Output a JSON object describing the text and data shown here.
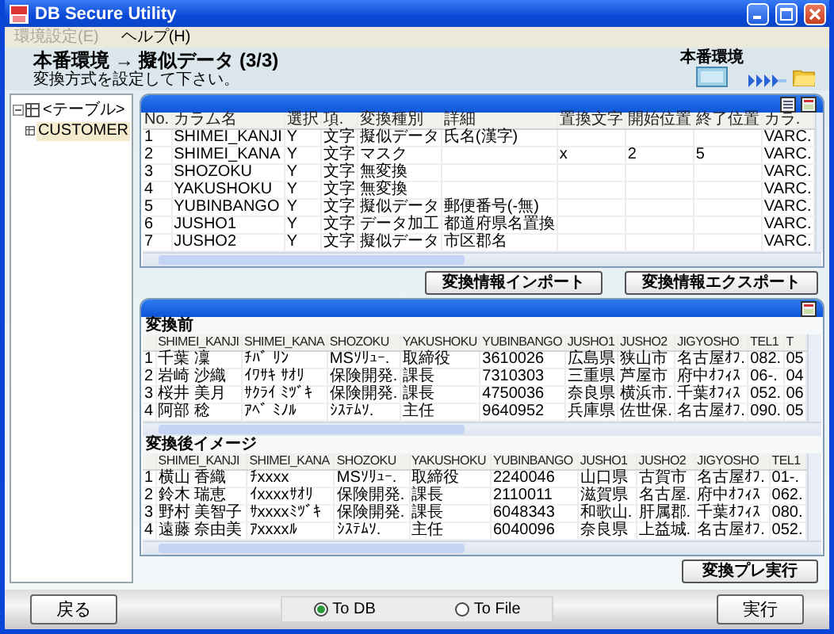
{
  "window": {
    "title": "DB Secure Utility"
  },
  "menu": [
    {
      "label": "環境設定(E)",
      "disabled": true
    },
    {
      "label": "ヘルプ(H)",
      "disabled": false
    }
  ],
  "header": {
    "title": "本番環境 → 擬似データ (3/3)",
    "subtitle": "変換方式を設定して下さい。",
    "icon_label": "本番環境"
  },
  "tree": {
    "label": "<テーブル>",
    "expanded": true,
    "children": [
      {
        "label": "CUSTOMER",
        "selected": true
      }
    ]
  },
  "settings_table": {
    "columns": [
      "No.",
      "カラム名",
      "選択",
      "項.",
      "変換種別",
      "詳細",
      "置換文字",
      "開始位置",
      "終了位置",
      "カラ."
    ],
    "rows": [
      [
        "1",
        "SHIMEI_KANJI",
        "Y",
        "文字",
        "擬似データ",
        "氏名(漢字)",
        null,
        null,
        null,
        "VARC."
      ],
      [
        "2",
        "SHIMEI_KANA",
        "Y",
        "文字",
        "マスク",
        null,
        "x",
        "2",
        "5",
        "VARC."
      ],
      [
        "3",
        "SHOZOKU",
        "Y",
        "文字",
        "無変換",
        null,
        null,
        null,
        null,
        "VARC."
      ],
      [
        "4",
        "YAKUSHOKU",
        "Y",
        "文字",
        "無変換",
        null,
        null,
        null,
        null,
        "VARC."
      ],
      [
        "5",
        "YUBINBANGO",
        "Y",
        "文字",
        "擬似データ",
        "郵便番号(-無)",
        null,
        null,
        null,
        "VARC."
      ],
      [
        "6",
        "JUSHO1",
        "Y",
        "文字",
        "データ加工",
        "都道府県名置換",
        null,
        null,
        null,
        "VARC."
      ],
      [
        "7",
        "JUSHO2",
        "Y",
        "文字",
        "擬似データ",
        "市区郡名",
        null,
        null,
        null,
        "VARC."
      ]
    ]
  },
  "settings_buttons": [
    "変換情報インポート",
    "変換情報エクスポート"
  ],
  "preview": {
    "before": {
      "label": "変換前",
      "columns": [
        "",
        "SHIMEI_KANJI",
        "SHIMEI_KANA",
        "SHOZOKU",
        "YAKUSHOKU",
        "YUBINBANGO",
        "JUSHO1",
        "JUSHO2",
        "JIGYOSHO",
        "TEL1",
        "T"
      ],
      "rows": [
        [
          "1",
          "千葉 凜",
          "ﾁﾊﾞ ﾘﾝ",
          "MSｿﾘｭｰ.",
          "取締役",
          "3610026",
          "広島県",
          "狭山市",
          "名古屋ｵﾌ.",
          "082.",
          "05"
        ],
        [
          "2",
          "岩崎 沙織",
          "ｲﾜｻｷ ｻｵﾘ",
          "保険開発.",
          "課長",
          "7310303",
          "三重県",
          "芦屋市",
          "府中ｵﾌｨｽ",
          "06-.",
          "04"
        ],
        [
          "3",
          "桜井 美月",
          "ｻｸﾗｲ ﾐﾂﾞｷ",
          "保険開発.",
          "課長",
          "4750036",
          "奈良県",
          "横浜市.",
          "千葉ｵﾌｨｽ",
          "052.",
          "06"
        ],
        [
          "4",
          "阿部 稔",
          "ｱﾍﾞ ﾐﾉﾙ",
          "ｼｽﾃﾑｿ.",
          "主任",
          "9640952",
          "兵庫県",
          "佐世保.",
          "名古屋ｵﾌ.",
          "090.",
          "05"
        ]
      ]
    },
    "after": {
      "label": "変換後イメージ",
      "columns": [
        "",
        "SHIMEI_KANJI",
        "SHIMEI_KANA",
        "SHOZOKU",
        "YAKUSHOKU",
        "YUBINBANGO",
        "JUSHO1",
        "JUSHO2",
        "JIGYOSHO",
        "TEL1"
      ],
      "rows": [
        [
          "1",
          "横山 香織",
          "ﾁxxxx",
          "MSｿﾘｭｰ.",
          "取締役",
          "2240046",
          "山口県",
          "古賀市",
          "名古屋ｵﾌ.",
          "01-."
        ],
        [
          "2",
          "鈴木 瑞恵",
          "ｲxxxxｻｵﾘ",
          "保険開発.",
          "課長",
          "2110011",
          "滋賀県",
          "名古屋.",
          "府中ｵﾌｨｽ",
          "062."
        ],
        [
          "3",
          "野村 美智子",
          "ｻxxxxﾐﾂﾞｷ",
          "保険開発.",
          "課長",
          "6048343",
          "和歌山.",
          "肝属郡.",
          "千葉ｵﾌｨｽ",
          "080."
        ],
        [
          "4",
          "遠藤 奈由美",
          "ｱxxxxﾙ",
          "ｼｽﾃﾑｿ.",
          "主任",
          "6040096",
          "奈良県",
          "上益城.",
          "名古屋ｵﾌ.",
          "052."
        ]
      ]
    }
  },
  "preview_button": "変換プレ実行",
  "footer": {
    "back": "戻る",
    "targets": [
      {
        "label": "To DB",
        "selected": true
      },
      {
        "label": "To File",
        "selected": false
      }
    ],
    "run": "実行"
  }
}
